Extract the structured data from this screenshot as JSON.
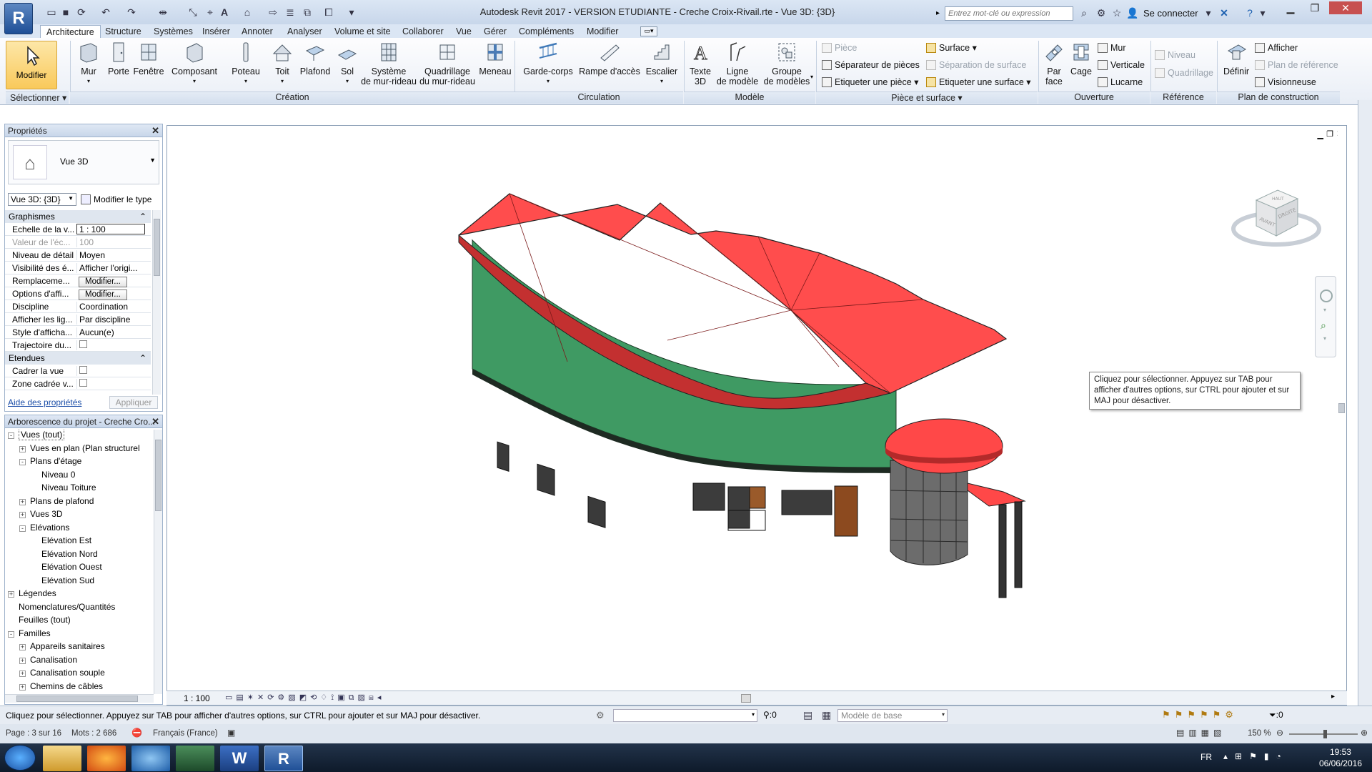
{
  "window": {
    "app_letter": "R",
    "title": "Autodesk Revit 2017 - VERSION ETUDIANTE -     Creche Croix-Rivail.rte - Vue 3D: {3D}",
    "search_placeholder": "Entrez mot-clé ou expression",
    "sign_in": "Se connecter"
  },
  "ribbon_tabs": [
    "Architecture",
    "Structure",
    "Systèmes",
    "Insérer",
    "Annoter",
    "Analyser",
    "Volume et site",
    "Collaborer",
    "Vue",
    "Gérer",
    "Compléments",
    "Modifier"
  ],
  "ribbon": {
    "modify": "Modifier",
    "select_label": "Sélectionner",
    "creation": {
      "label": "Création",
      "buttons": [
        "Mur",
        "Porte",
        "Fenêtre",
        "Composant",
        "Poteau",
        "Toit",
        "Plafond",
        "Sol",
        "Système\nde mur-rideau",
        "Quadrillage\ndu mur-rideau",
        "Meneau"
      ]
    },
    "circulation": {
      "label": "Circulation",
      "buttons": [
        "Garde-corps",
        "Rampe d'accès",
        "Escalier"
      ]
    },
    "model": {
      "label": "Modèle",
      "buttons": [
        "Texte\n3D",
        "Ligne\nde modèle",
        "Groupe\nde modèles"
      ]
    },
    "room": {
      "label": "Pièce et surface",
      "items": [
        "Pièce",
        "Séparateur de pièces",
        "Etiqueter une pièce",
        "Surface",
        "Séparation de surface",
        "Etiqueter une surface"
      ]
    },
    "opening": {
      "label": "Ouverture",
      "big": [
        "Par\nface",
        "Cage"
      ],
      "items": [
        "Mur",
        "Verticale",
        "Lucarne"
      ]
    },
    "datum": {
      "label": "Référence",
      "items": [
        "Niveau",
        "Quadrillage"
      ]
    },
    "workplane": {
      "label": "Plan de construction",
      "big": "Définir",
      "items": [
        "Afficher",
        "Plan de référence",
        "Visionneuse"
      ]
    }
  },
  "properties": {
    "title": "Propriétés",
    "type_name": "Vue 3D",
    "view_selector": "Vue 3D: {3D}",
    "edit_type": "Modifier le type",
    "group_graphics": "Graphismes",
    "rows": [
      {
        "k": "Echelle de la v...",
        "v": "1 : 100"
      },
      {
        "k": "Valeur de l'éc...",
        "v": "100"
      },
      {
        "k": "Niveau de détail",
        "v": "Moyen"
      },
      {
        "k": "Visibilité des é...",
        "v": "Afficher l'origi..."
      },
      {
        "k": "Remplaceme...",
        "v": "Modifier..."
      },
      {
        "k": "Options d'affi...",
        "v": "Modifier..."
      },
      {
        "k": "Discipline",
        "v": "Coordination"
      },
      {
        "k": "Afficher les lig...",
        "v": "Par discipline"
      },
      {
        "k": "Style d'afficha...",
        "v": "Aucun(e)"
      },
      {
        "k": "Trajectoire du...",
        "v": ""
      }
    ],
    "group_extents": "Etendues",
    "extent_rows": [
      {
        "k": "Cadrer la vue",
        "v": ""
      },
      {
        "k": "Zone cadrée v...",
        "v": ""
      }
    ],
    "help_link": "Aide des propriétés",
    "apply": "Appliquer"
  },
  "browser": {
    "title": "Arborescence du projet - Creche Cro...",
    "nodes": [
      {
        "text": "Vues (tout)",
        "level": 0,
        "pm": "-"
      },
      {
        "text": "Vues en plan (Plan structurel",
        "level": 1,
        "pm": "+"
      },
      {
        "text": "Plans d'étage",
        "level": 1,
        "pm": "-"
      },
      {
        "text": "Niveau 0",
        "level": 2,
        "pm": ""
      },
      {
        "text": "Niveau Toiture",
        "level": 2,
        "pm": ""
      },
      {
        "text": "Plans de plafond",
        "level": 1,
        "pm": "+"
      },
      {
        "text": "Vues 3D",
        "level": 1,
        "pm": "+"
      },
      {
        "text": "Elévations",
        "level": 1,
        "pm": "-"
      },
      {
        "text": "Elévation Est",
        "level": 2,
        "pm": ""
      },
      {
        "text": "Elévation Nord",
        "level": 2,
        "pm": ""
      },
      {
        "text": "Elévation Ouest",
        "level": 2,
        "pm": ""
      },
      {
        "text": "Elévation Sud",
        "level": 2,
        "pm": ""
      },
      {
        "text": "Légendes",
        "level": 0,
        "pm": "+"
      },
      {
        "text": "Nomenclatures/Quantités",
        "level": 0,
        "pm": ""
      },
      {
        "text": "Feuilles (tout)",
        "level": 0,
        "pm": ""
      },
      {
        "text": "Familles",
        "level": 0,
        "pm": "-"
      },
      {
        "text": "Appareils sanitaires",
        "level": 1,
        "pm": "+"
      },
      {
        "text": "Canalisation",
        "level": 1,
        "pm": "+"
      },
      {
        "text": "Canalisation souple",
        "level": 1,
        "pm": "+"
      },
      {
        "text": "Chemins de câbles",
        "level": 1,
        "pm": "+"
      }
    ]
  },
  "viewport": {
    "tooltip": "Cliquez pour sélectionner. Appuyez sur TAB pour afficher d'autres options, sur CTRL pour ajouter et sur MAJ pour désactiver.",
    "viewcube_top": "HAUT",
    "viewcube_front": "AVANT",
    "viewcube_right": "DROITE",
    "scale": "1 : 100"
  },
  "status": {
    "message": "Cliquez pour sélectionner. Appuyez sur TAB pour afficher d'autres options, sur CTRL pour ajouter et sur MAJ pour désactiver.",
    "worksets_count": ":0",
    "model": "Modèle de base",
    "filter_count": ":0"
  },
  "word_status": {
    "page": "Page : 3 sur 16",
    "words": "Mots : 2 686",
    "lang": "Français (France)",
    "zoom": "150 %"
  },
  "taskbar": {
    "lang": "FR",
    "time": "19:53",
    "date": "06/06/2016"
  },
  "colors": {
    "roof": "#ff4848",
    "walls": "#3f9a63",
    "ribbon_bg": "#e9eef6",
    "title_bg": "#c7d6ea"
  }
}
